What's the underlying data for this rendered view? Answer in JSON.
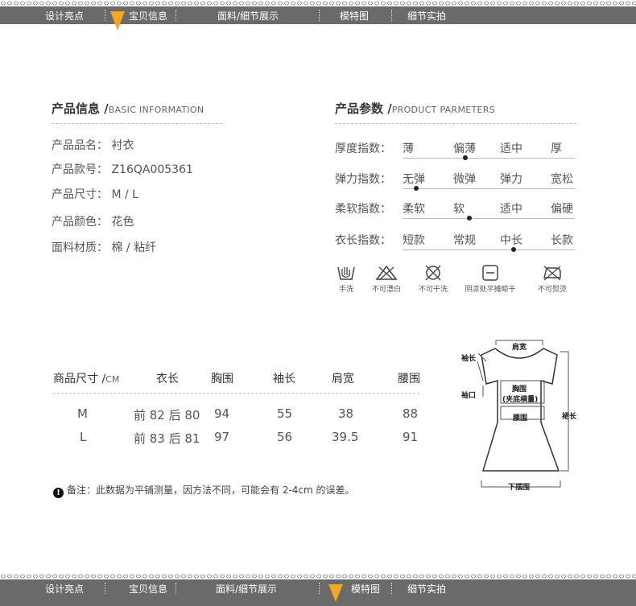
{
  "nav": {
    "tabs": [
      "设计亮点",
      "宝贝信息",
      "面料/细节展示",
      "模特图",
      "细节实拍"
    ]
  },
  "basic": {
    "title": "产品信息 /",
    "subtitle": "BASIC INFORMATION",
    "rows": [
      {
        "label": "产品品名：",
        "value": "衬衣"
      },
      {
        "label": "产品款号：",
        "value": "Z16QA005361"
      },
      {
        "label": "产品尺寸：",
        "value": "M / L"
      },
      {
        "label": "产品颜色：",
        "value": "花色"
      },
      {
        "label": "面料材质：",
        "value": "棉 / 粘纤"
      }
    ]
  },
  "params": {
    "title": "产品参数 /",
    "subtitle": "PRODUCT PARMETERS",
    "rows": [
      {
        "label": "厚度指数：",
        "options": [
          "薄",
          "偏薄",
          "适中",
          "厚"
        ],
        "selected": 1
      },
      {
        "label": "弹力指数：",
        "options": [
          "无弹",
          "微弹",
          "弹力",
          "宽松"
        ],
        "selected": 0
      },
      {
        "label": "柔软指数：",
        "options": [
          "柔软",
          "软",
          "适中",
          "偏硬"
        ],
        "selected": 1
      },
      {
        "label": "衣长指数：",
        "options": [
          "短款",
          "常规",
          "中长",
          "长款"
        ],
        "selected": 2
      }
    ]
  },
  "care": {
    "items": [
      {
        "icon": "hand-wash-icon",
        "label": "手洗"
      },
      {
        "icon": "no-bleach-icon",
        "label": "不可漂白"
      },
      {
        "icon": "no-dry-clean-icon",
        "label": "不可干洗"
      },
      {
        "icon": "shade-dry-flat-icon",
        "label": "阴凉处平摊晾干"
      },
      {
        "icon": "no-iron-icon",
        "label": "不可熨烫"
      }
    ]
  },
  "size_table": {
    "header_label": "商品尺寸 /",
    "header_unit": "CM",
    "columns": [
      "衣长",
      "胸围",
      "袖长",
      "肩宽",
      "腰围"
    ],
    "rows": [
      {
        "size": "M",
        "cells": [
          "前 82 后 80",
          "94",
          "55",
          "38",
          "88"
        ]
      },
      {
        "size": "L",
        "cells": [
          "前 83 后 81",
          "97",
          "56",
          "39.5",
          "91"
        ]
      }
    ]
  },
  "note": "备注：此数据为平铺测量，因方法不同，可能会有 2-4cm 的误差。",
  "diagram": {
    "labels": {
      "shoulder": "肩宽",
      "sleeve": "袖长",
      "cuff": "袖口",
      "chest": "胸围",
      "chest_note": "(夹底横量)",
      "waist": "腰围",
      "length": "裙长",
      "hem": "下摆围"
    }
  },
  "colors": {
    "nav_bg": "#6a6a6a",
    "accent": "#f5a623",
    "dot": "#222222"
  }
}
